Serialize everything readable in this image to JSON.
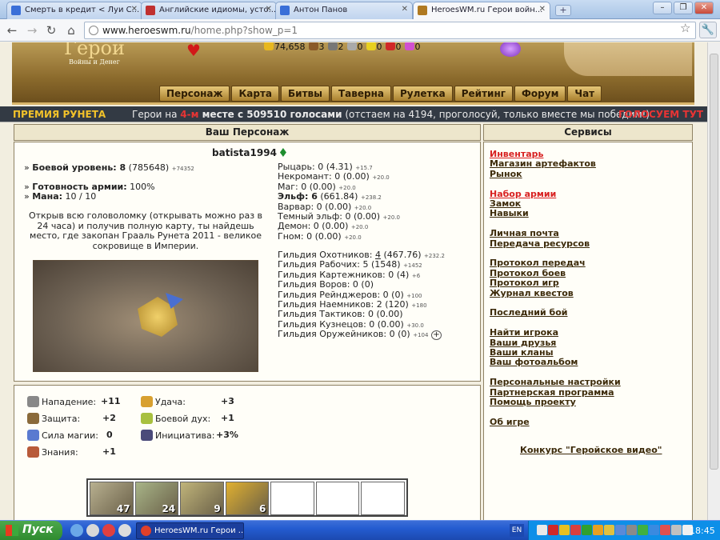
{
  "browser": {
    "tabs": [
      {
        "title": "Смерть в кредит < Луи С...",
        "icon_color": "#3a6fd8",
        "active": false
      },
      {
        "title": "Английские идиомы, усто...",
        "icon_color": "#c03030",
        "active": false
      },
      {
        "title": "Антон Панов",
        "icon_color": "#3a6fd8",
        "active": false
      },
      {
        "title": "HeroesWM.ru Герои войн...",
        "icon_color": "#b07a22",
        "active": true
      }
    ],
    "new_tab_label": "+",
    "url_host": "www.heroeswm.ru",
    "url_path": "/home.php?show_p=1",
    "win_buttons": [
      "–",
      "❐",
      "✕"
    ]
  },
  "site": {
    "logo_title": "Герои",
    "logo_subtitle": "Войны и Денег",
    "resources": [
      {
        "name": "gold",
        "value": "74,658",
        "color": "#e8b820"
      },
      {
        "name": "wood",
        "value": "3",
        "color": "#8a5a2a"
      },
      {
        "name": "ore",
        "value": "2",
        "color": "#777"
      },
      {
        "name": "mercury",
        "value": "0",
        "color": "#aaa"
      },
      {
        "name": "sulfur",
        "value": "0",
        "color": "#e8d020"
      },
      {
        "name": "crystals",
        "value": "0",
        "color": "#d02828"
      },
      {
        "name": "gems",
        "value": "0",
        "color": "#d050d0"
      }
    ],
    "menu": [
      "Персонаж",
      "Карта",
      "Битвы",
      "Таверна",
      "Рулетка",
      "Рейтинг",
      "Форум",
      "Чат"
    ]
  },
  "premium": {
    "label": "ПРЕМИЯ РУНЕТА",
    "text_pre": "Герои на ",
    "rank": "4-м",
    "text_bold": " месте с 509510 голосами",
    "text_post": " (отстаем на 4194, проголосуй, только вместе мы победим!)",
    "vote_link": "ГОЛОСУЕМ ТУТ"
  },
  "character": {
    "header": "Ваш Персонаж",
    "name": "batista1994",
    "combat_level_label": "Боевой уровень: 8",
    "combat_level_exp": " (785648)",
    "combat_level_delta": "+74352",
    "army_ready_label": "Готовность армии:",
    "army_ready_value": " 100%",
    "mana_label": "Мана:",
    "mana_value": " 10 / 10",
    "story": "Открыв всю головоломку (открывать можно раз в 24 часа) и получив полную карту, ты найдешь место, где закопан Грааль Рунета 2011 - великое сокровище в Империи.",
    "factions": [
      {
        "text": "Рыцарь: 0 (4.31)",
        "delta": "+15.7",
        "bold": false
      },
      {
        "text": "Некромант: 0 (0.00)",
        "delta": "+20.0",
        "bold": false
      },
      {
        "text": "Маг: 0 (0.00)",
        "delta": "+20.0",
        "bold": false
      },
      {
        "text_bold": "Эльф: 6",
        "text": " (661.84)",
        "delta": "+238.2",
        "bold": true
      },
      {
        "text": "Варвар: 0 (0.00)",
        "delta": "+20.0",
        "bold": false
      },
      {
        "text": "Темный эльф: 0 (0.00)",
        "delta": "+20.0",
        "bold": false
      },
      {
        "text": "Демон: 0 (0.00)",
        "delta": "+20.0",
        "bold": false
      },
      {
        "text": "Гном: 0 (0.00)",
        "delta": "+20.0",
        "bold": false
      }
    ],
    "guilds": [
      {
        "text_pre": "Гильдия Охотников: ",
        "text_u": "4",
        "text": " (467.76)",
        "delta": "+232.2"
      },
      {
        "text_pre": "Гильдия Рабочих: 5 (1548)",
        "text_u": "",
        "text": "",
        "delta": "+1452"
      },
      {
        "text_pre": "Гильдия Картежников: 0 (4)",
        "text_u": "",
        "text": "",
        "delta": "+6"
      },
      {
        "text_pre": "Гильдия Воров: 0 (0)",
        "text_u": "",
        "text": "",
        "delta": ""
      },
      {
        "text_pre": "Гильдия Рейнджеров: 0 (0)",
        "text_u": "",
        "text": "",
        "delta": "+100"
      },
      {
        "text_pre": "Гильдия Наемников: 2 (120)",
        "text_u": "",
        "text": "",
        "delta": "+180"
      },
      {
        "text_pre": "Гильдия Тактиков: 0 (0.00)",
        "text_u": "",
        "text": "",
        "delta": ""
      },
      {
        "text_pre": "Гильдия Кузнецов: 0 (0.00)",
        "text_u": "",
        "text": "",
        "delta": "+30.0"
      },
      {
        "text_pre": "Гильдия Оружейников: 0 (0)",
        "text_u": "",
        "text": "",
        "delta": "+104"
      }
    ],
    "guild_more": "+",
    "stats": [
      {
        "label": "Нападение:",
        "value": "+11",
        "icon": "swords-icon",
        "color": "#888"
      },
      {
        "label": "Защита:",
        "value": "+2",
        "icon": "shield-icon",
        "color": "#8a6a3a"
      },
      {
        "label": "Сила магии:",
        "value": "0",
        "icon": "wand-icon",
        "color": "#5a7ad0"
      },
      {
        "label": "Знания:",
        "value": "+1",
        "icon": "book-icon",
        "color": "#b85a3a"
      },
      {
        "label": "Удача:",
        "value": "+3",
        "icon": "rainbow-icon",
        "color": "#d8a030"
      },
      {
        "label": "Боевой дух:",
        "value": "+1",
        "icon": "wings-icon",
        "color": "#a8c040"
      },
      {
        "label": "Инициатива:",
        "value": "+3%",
        "icon": "potion-icon",
        "color": "#4a4a7a"
      }
    ],
    "army": [
      {
        "count": "47",
        "color": "#b8b090"
      },
      {
        "count": "24",
        "color": "#a8b488"
      },
      {
        "count": "9",
        "color": "#c0b47a"
      },
      {
        "count": "6",
        "color": "#e0b030"
      },
      {
        "count": "",
        "color": "#ffffff"
      },
      {
        "count": "",
        "color": "#ffffff"
      },
      {
        "count": "",
        "color": "#ffffff"
      }
    ]
  },
  "services": {
    "header": "Сервисы",
    "groups": [
      [
        {
          "label": "Инвентарь",
          "red": true
        },
        {
          "label": "Магазин артефактов",
          "red": false
        },
        {
          "label": "Рынок",
          "red": false
        }
      ],
      [
        {
          "label": "Набор армии",
          "red": true
        },
        {
          "label": "Замок",
          "red": false
        },
        {
          "label": "Навыки",
          "red": false
        }
      ],
      [
        {
          "label": "Личная почта",
          "red": false
        },
        {
          "label": "Передача ресурсов",
          "red": false
        }
      ],
      [
        {
          "label": "Протокол передач",
          "red": false
        },
        {
          "label": "Протокол боев",
          "red": false
        },
        {
          "label": "Протокол игр",
          "red": false
        },
        {
          "label": "Журнал квестов",
          "red": false
        }
      ],
      [
        {
          "label": "Последний бой",
          "red": false
        }
      ],
      [
        {
          "label": "Найти игрока",
          "red": false
        },
        {
          "label": "Ваши друзья",
          "red": false
        },
        {
          "label": "Ваши кланы",
          "red": false
        },
        {
          "label": "Ваш фотоальбом",
          "red": false
        }
      ],
      [
        {
          "label": "Персональные настройки",
          "red": false
        },
        {
          "label": "Партнерская программа",
          "red": false
        },
        {
          "label": "Помощь проекту",
          "red": false
        }
      ],
      [
        {
          "label": "Об игре",
          "red": false
        }
      ]
    ],
    "contest": "Конкурс \"Геройское видео\""
  },
  "taskbar": {
    "start_label": "Пуск",
    "task_title": "HeroesWM.ru Герои ...",
    "lang": "EN",
    "clock": "18:45"
  }
}
